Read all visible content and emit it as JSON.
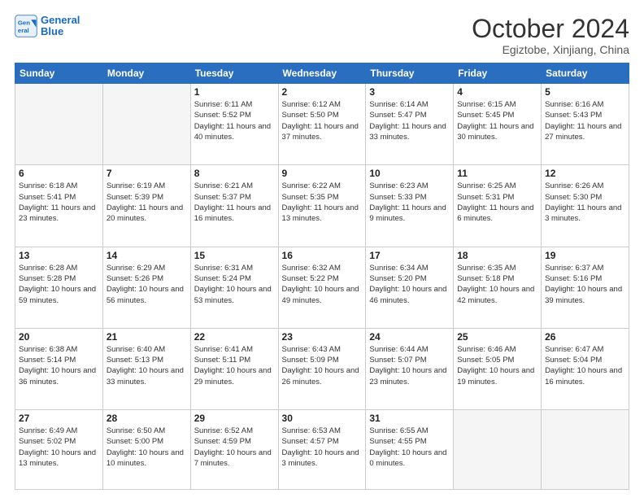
{
  "header": {
    "logo_line1": "General",
    "logo_line2": "Blue",
    "month": "October 2024",
    "location": "Egiztobe, Xinjiang, China"
  },
  "weekdays": [
    "Sunday",
    "Monday",
    "Tuesday",
    "Wednesday",
    "Thursday",
    "Friday",
    "Saturday"
  ],
  "weeks": [
    [
      {
        "day": "",
        "info": ""
      },
      {
        "day": "",
        "info": ""
      },
      {
        "day": "1",
        "info": "Sunrise: 6:11 AM\nSunset: 5:52 PM\nDaylight: 11 hours and 40 minutes."
      },
      {
        "day": "2",
        "info": "Sunrise: 6:12 AM\nSunset: 5:50 PM\nDaylight: 11 hours and 37 minutes."
      },
      {
        "day": "3",
        "info": "Sunrise: 6:14 AM\nSunset: 5:47 PM\nDaylight: 11 hours and 33 minutes."
      },
      {
        "day": "4",
        "info": "Sunrise: 6:15 AM\nSunset: 5:45 PM\nDaylight: 11 hours and 30 minutes."
      },
      {
        "day": "5",
        "info": "Sunrise: 6:16 AM\nSunset: 5:43 PM\nDaylight: 11 hours and 27 minutes."
      }
    ],
    [
      {
        "day": "6",
        "info": "Sunrise: 6:18 AM\nSunset: 5:41 PM\nDaylight: 11 hours and 23 minutes."
      },
      {
        "day": "7",
        "info": "Sunrise: 6:19 AM\nSunset: 5:39 PM\nDaylight: 11 hours and 20 minutes."
      },
      {
        "day": "8",
        "info": "Sunrise: 6:21 AM\nSunset: 5:37 PM\nDaylight: 11 hours and 16 minutes."
      },
      {
        "day": "9",
        "info": "Sunrise: 6:22 AM\nSunset: 5:35 PM\nDaylight: 11 hours and 13 minutes."
      },
      {
        "day": "10",
        "info": "Sunrise: 6:23 AM\nSunset: 5:33 PM\nDaylight: 11 hours and 9 minutes."
      },
      {
        "day": "11",
        "info": "Sunrise: 6:25 AM\nSunset: 5:31 PM\nDaylight: 11 hours and 6 minutes."
      },
      {
        "day": "12",
        "info": "Sunrise: 6:26 AM\nSunset: 5:30 PM\nDaylight: 11 hours and 3 minutes."
      }
    ],
    [
      {
        "day": "13",
        "info": "Sunrise: 6:28 AM\nSunset: 5:28 PM\nDaylight: 10 hours and 59 minutes."
      },
      {
        "day": "14",
        "info": "Sunrise: 6:29 AM\nSunset: 5:26 PM\nDaylight: 10 hours and 56 minutes."
      },
      {
        "day": "15",
        "info": "Sunrise: 6:31 AM\nSunset: 5:24 PM\nDaylight: 10 hours and 53 minutes."
      },
      {
        "day": "16",
        "info": "Sunrise: 6:32 AM\nSunset: 5:22 PM\nDaylight: 10 hours and 49 minutes."
      },
      {
        "day": "17",
        "info": "Sunrise: 6:34 AM\nSunset: 5:20 PM\nDaylight: 10 hours and 46 minutes."
      },
      {
        "day": "18",
        "info": "Sunrise: 6:35 AM\nSunset: 5:18 PM\nDaylight: 10 hours and 42 minutes."
      },
      {
        "day": "19",
        "info": "Sunrise: 6:37 AM\nSunset: 5:16 PM\nDaylight: 10 hours and 39 minutes."
      }
    ],
    [
      {
        "day": "20",
        "info": "Sunrise: 6:38 AM\nSunset: 5:14 PM\nDaylight: 10 hours and 36 minutes."
      },
      {
        "day": "21",
        "info": "Sunrise: 6:40 AM\nSunset: 5:13 PM\nDaylight: 10 hours and 33 minutes."
      },
      {
        "day": "22",
        "info": "Sunrise: 6:41 AM\nSunset: 5:11 PM\nDaylight: 10 hours and 29 minutes."
      },
      {
        "day": "23",
        "info": "Sunrise: 6:43 AM\nSunset: 5:09 PM\nDaylight: 10 hours and 26 minutes."
      },
      {
        "day": "24",
        "info": "Sunrise: 6:44 AM\nSunset: 5:07 PM\nDaylight: 10 hours and 23 minutes."
      },
      {
        "day": "25",
        "info": "Sunrise: 6:46 AM\nSunset: 5:05 PM\nDaylight: 10 hours and 19 minutes."
      },
      {
        "day": "26",
        "info": "Sunrise: 6:47 AM\nSunset: 5:04 PM\nDaylight: 10 hours and 16 minutes."
      }
    ],
    [
      {
        "day": "27",
        "info": "Sunrise: 6:49 AM\nSunset: 5:02 PM\nDaylight: 10 hours and 13 minutes."
      },
      {
        "day": "28",
        "info": "Sunrise: 6:50 AM\nSunset: 5:00 PM\nDaylight: 10 hours and 10 minutes."
      },
      {
        "day": "29",
        "info": "Sunrise: 6:52 AM\nSunset: 4:59 PM\nDaylight: 10 hours and 7 minutes."
      },
      {
        "day": "30",
        "info": "Sunrise: 6:53 AM\nSunset: 4:57 PM\nDaylight: 10 hours and 3 minutes."
      },
      {
        "day": "31",
        "info": "Sunrise: 6:55 AM\nSunset: 4:55 PM\nDaylight: 10 hours and 0 minutes."
      },
      {
        "day": "",
        "info": ""
      },
      {
        "day": "",
        "info": ""
      }
    ]
  ]
}
